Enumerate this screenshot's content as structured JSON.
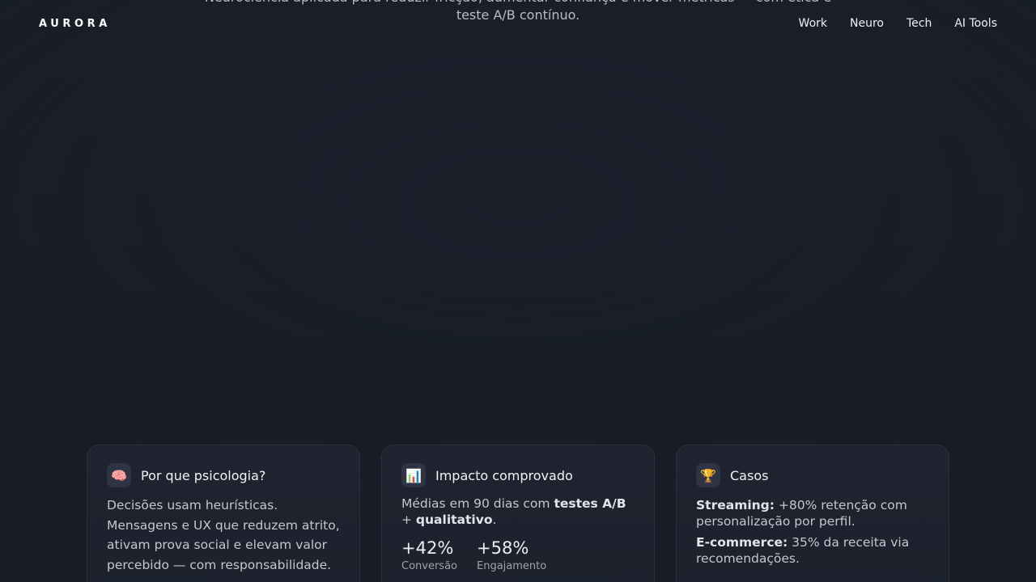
{
  "brand": {
    "logo": "AURORA"
  },
  "nav": {
    "items": [
      "Work",
      "Neuro",
      "Tech",
      "AI Tools"
    ]
  },
  "hero": {
    "subtitle_line1": "Neurociência aplicada para reduzir fricção, aumentar confiança e mover métricas — com ética e",
    "subtitle_line2": "teste A/B contínuo."
  },
  "cards": {
    "psychology": {
      "icon": "brain-icon",
      "title": "Por que psicologia?",
      "body": "Decisões usam heurísticas. Mensagens e UX que reduzem atrito, ativam prova social e elevam valor percebido — com responsabilidade."
    },
    "impact": {
      "icon": "bar-chart-icon",
      "title": "Impacto comprovado",
      "body_prefix": "Médias em 90 dias com ",
      "body_bold1": "testes A/B",
      "body_mid": " + ",
      "body_bold2": "qualitativo",
      "body_suffix": ".",
      "stats": [
        {
          "value": "+42%",
          "label": "Conversão"
        },
        {
          "value": "+58%",
          "label": "Engajamento"
        }
      ]
    },
    "cases": {
      "icon": "trophy-icon",
      "title": "Casos",
      "items": [
        {
          "label": "Streaming:",
          "text": " +80% retenção com personalização por perfil."
        },
        {
          "label": "E-commerce:",
          "text": " 35% da receita via recomendações."
        }
      ]
    }
  }
}
